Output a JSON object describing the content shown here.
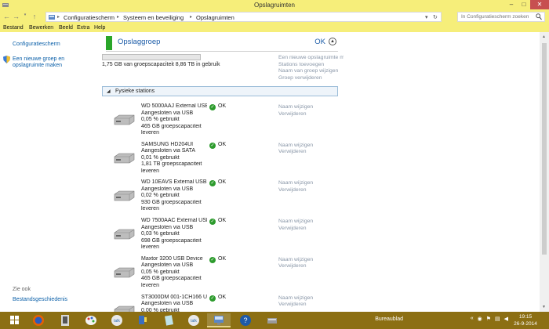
{
  "window": {
    "title": "Opslagruimten"
  },
  "address": {
    "crumbs": [
      "Configuratiescherm",
      "Systeem en beveiliging",
      "Opslagruimten"
    ],
    "search_placeholder": "In Configuratiescherm zoeken"
  },
  "menu": [
    "Bestand",
    "Bewerken",
    "Beeld",
    "Extra",
    "Help"
  ],
  "sidebar": {
    "home": "Configuratiescherm",
    "create_line1": "Een nieuwe groep en",
    "create_line2": "opslagruimte maken",
    "see_also": "Zie ook",
    "history": "Bestandsgeschiedenis"
  },
  "pool": {
    "title": "Opslaggroep",
    "status": "OK",
    "usage_fraction": 0.0002,
    "capacity_text": "1,75 GB van groepscapaciteit 8,86 TB in gebruik",
    "actions": [
      "Een nieuwe opslagruimte maken",
      "Stations toevoegen",
      "Naam van groep wijzigen",
      "Groep verwijderen"
    ],
    "section_label": "Fysieke stations"
  },
  "drives": [
    {
      "name": "WD 5000AAJ External USB ...",
      "connection": "Aangesloten via USB",
      "usage": "0,05 % gebruikt",
      "capacity": "465 GB groepscapaciteit",
      "capacity2": "leveren",
      "status": "OK",
      "actions": [
        "Naam wijzigen",
        "Verwijderen"
      ]
    },
    {
      "name": "SAMSUNG HD204UI",
      "connection": "Aangesloten via SATA",
      "usage": "0,01 % gebruikt",
      "capacity": "1,81 TB groepscapaciteit",
      "capacity2": "leveren",
      "status": "OK",
      "actions": [
        "Naam wijzigen",
        "Verwijderen"
      ]
    },
    {
      "name": "WD 10EAVS External USB ...",
      "connection": "Aangesloten via USB",
      "usage": "0,02 % gebruikt",
      "capacity": "930 GB groepscapaciteit",
      "capacity2": "leveren",
      "status": "OK",
      "actions": [
        "Naam wijzigen",
        "Verwijderen"
      ]
    },
    {
      "name": "WD 7500AAC External USB...",
      "connection": "Aangesloten via USB",
      "usage": "0,03 % gebruikt",
      "capacity": "698 GB groepscapaciteit",
      "capacity2": "leveren",
      "status": "OK",
      "actions": [
        "Naam wijzigen",
        "Verwijderen"
      ]
    },
    {
      "name": "Maxtor 3200 USB Device",
      "connection": "Aangesloten via USB",
      "usage": "0,05 % gebruikt",
      "capacity": "465 GB groepscapaciteit",
      "capacity2": "leveren",
      "status": "OK",
      "actions": [
        "Naam wijzigen",
        "Verwijderen"
      ]
    },
    {
      "name": "ST3000DM 001-1CH166 U...",
      "connection": "Aangesloten via USB",
      "usage": "0,00 % gebruikt",
      "capacity": "",
      "capacity2": "",
      "status": "OK",
      "actions": [
        "Naam wijzigen",
        "Verwijderen"
      ]
    }
  ],
  "taskbar": {
    "desktop_label": "Bureaublad",
    "time": "19:15",
    "date": "26-9-2014",
    "apps": [
      "start-orb-icon",
      "firefox-icon",
      "chess-icon",
      "paint-icon",
      "talk-icon",
      "flag-icon",
      "talk-icon",
      "monitor-icon",
      "help-icon",
      "storage-icon"
    ]
  },
  "colors": {
    "accent_bar": "#f6ee7a",
    "taskbar": "#8c6f13",
    "link": "#0a5fa8",
    "ok_green": "#2d9b2d",
    "close": "#c75050"
  }
}
